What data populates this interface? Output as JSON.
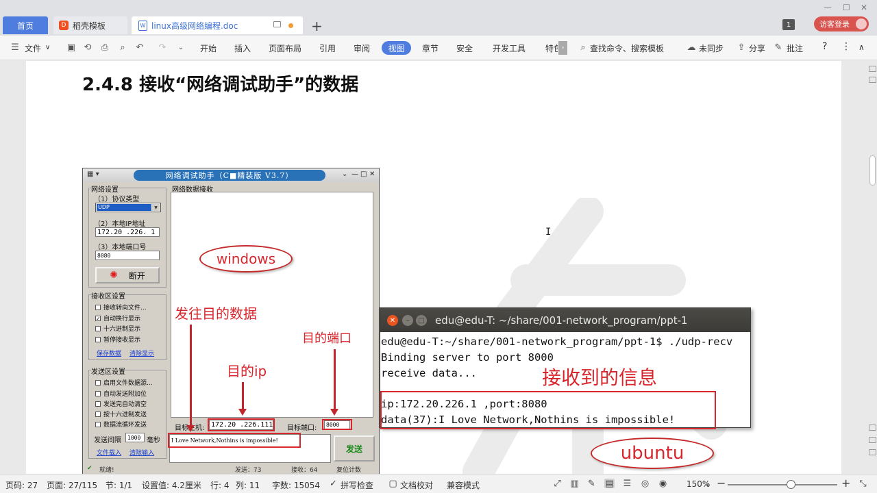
{
  "tabs": {
    "home": "首页",
    "template": "稻壳模板",
    "template_logo": "D",
    "doc": "linux高级网络编程.doc",
    "add": "+"
  },
  "window": {
    "minimize": "—",
    "maximize": "☐",
    "close": "✕",
    "page_badge": "1",
    "login": "访客登录"
  },
  "ribbon": {
    "file": "文件",
    "file_arrow": "∨",
    "items": [
      "开始",
      "插入",
      "页面布局",
      "引用",
      "审阅",
      "视图",
      "章节",
      "安全",
      "开发工具",
      "特色"
    ],
    "active_tab": "视图",
    "more": "›",
    "search": "查找命令、搜索模板",
    "unsynced": "未同步",
    "share": "分享",
    "comment": "批注",
    "help": "?",
    "menu": "⋮",
    "collapse": "∧"
  },
  "document": {
    "heading": "2.4.8 接收“网络调试助手”的数据"
  },
  "net_assistant": {
    "title": "网络调试助手（C■精装版 V3.7）",
    "net_settings": "网络设置",
    "protocol_label": "（1）协议类型",
    "protocol_value": "UDP",
    "local_ip_label": "（2）本地IP地址",
    "local_ip": "172.20 .226. 1",
    "local_port_label": "（3）本地端口号",
    "local_port": "8080",
    "disconnect": "断开",
    "recv_settings": "接收区设置",
    "recv_opts": [
      "接收转向文件...",
      "自动换行显示",
      "十六进制显示",
      "暂停接收显示"
    ],
    "save_data": "保存数据",
    "clear_display": "清除显示",
    "send_settings": "发送区设置",
    "send_opts": [
      "启用文件数据源...",
      "自动发送附加位",
      "发送完自动清空",
      "按十六进制发送",
      "数据流循环发送"
    ],
    "interval_label": "发送间隔",
    "interval": "1000",
    "ms": "毫秒",
    "file_load": "文件载入",
    "clear_input": "清除输入",
    "recv_area": "网络数据接收",
    "target_host_label": "目标主机:",
    "target_host": "172.20 .226.111",
    "target_port_label": "目标端口:",
    "target_port": "8000",
    "send_text": "I Love Network,Nothins is impossible!",
    "send": "发送",
    "ready": "就绪!",
    "send_count": "发送：73",
    "recv_count": "接收：64",
    "reset": "复位计数"
  },
  "annotations": {
    "windows": "windows",
    "ubuntu": "ubuntu",
    "send_data": "发往目的数据",
    "dest_port": "目的端口",
    "dest_ip": "目的ip",
    "received_info": "接收到的信息"
  },
  "terminal": {
    "title": "edu@edu-T: ~/share/001-network_program/ppt-1",
    "lines": [
      "edu@edu-T:~/share/001-network_program/ppt-1$ ./udp-recv",
      "Binding server to port 8000",
      "receive data...",
      "",
      "ip:172.20.226.1 ,port:8080",
      "data(37):I Love Network,Nothins is impossible!"
    ]
  },
  "statusbar": {
    "page_num": "页码: 27",
    "pages": "页面: 27/115",
    "section": "节: 1/1",
    "setting": "设置值: 4.2厘米",
    "row": "行: 4",
    "col": "列: 11",
    "words": "字数: 15054",
    "spell": "拼写检查",
    "proof": "文档校对",
    "compat": "兼容模式",
    "zoom": "150%",
    "zoom_level_percent": 150
  },
  "colors": {
    "accent": "#4e7ddf",
    "annotation_red": "#d7262c",
    "login": "#d9534f"
  }
}
